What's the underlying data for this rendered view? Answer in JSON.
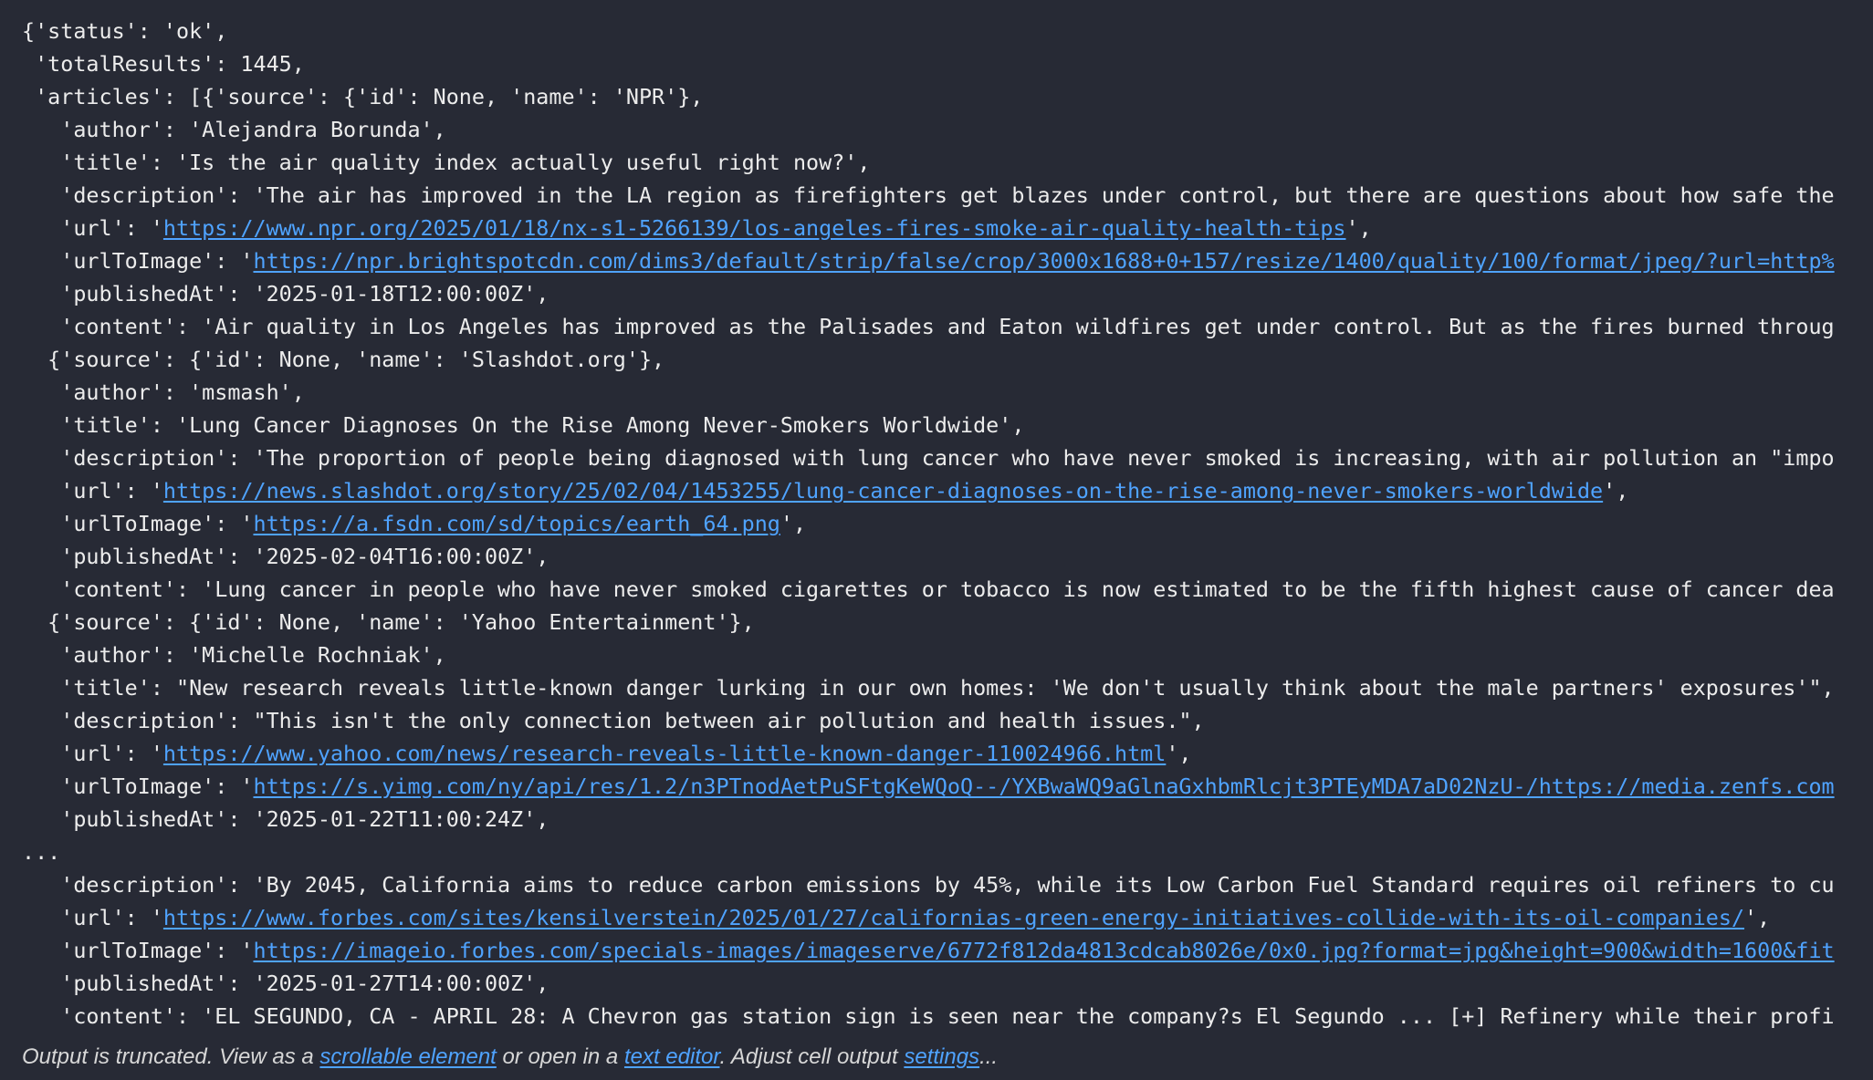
{
  "output": {
    "lines": [
      {
        "text": "{'status': 'ok',"
      },
      {
        "text": " 'totalResults': 1445,"
      },
      {
        "text": " 'articles': [{'source': {'id': None, 'name': 'NPR'},"
      },
      {
        "text": "   'author': 'Alejandra Borunda',"
      },
      {
        "text": "   'title': 'Is the air quality index actually useful right now?',"
      },
      {
        "text": "   'description': 'The air has improved in the LA region as firefighters get blazes under control, but there are questions about how safe the"
      },
      {
        "prefix": "   'url': '",
        "link": "https://www.npr.org/2025/01/18/nx-s1-5266139/los-angeles-fires-smoke-air-quality-health-tips",
        "suffix": "',"
      },
      {
        "prefix": "   'urlToImage': '",
        "link": "https://npr.brightspotcdn.com/dims3/default/strip/false/crop/3000x1688+0+157/resize/1400/quality/100/format/jpeg/?url=http%",
        "suffix": ""
      },
      {
        "text": "   'publishedAt': '2025-01-18T12:00:00Z',"
      },
      {
        "text": "   'content': 'Air quality in Los Angeles has improved as the Palisades and Eaton wildfires get under control. But as the fires burned throug"
      },
      {
        "text": "  {'source': {'id': None, 'name': 'Slashdot.org'},"
      },
      {
        "text": "   'author': 'msmash',"
      },
      {
        "text": "   'title': 'Lung Cancer Diagnoses On the Rise Among Never-Smokers Worldwide',"
      },
      {
        "text": "   'description': 'The proportion of people being diagnosed with lung cancer who have never smoked is increasing, with air pollution an \"impo"
      },
      {
        "prefix": "   'url': '",
        "link": "https://news.slashdot.org/story/25/02/04/1453255/lung-cancer-diagnoses-on-the-rise-among-never-smokers-worldwide",
        "suffix": "',"
      },
      {
        "prefix": "   'urlToImage': '",
        "link": "https://a.fsdn.com/sd/topics/earth_64.png",
        "suffix": "',"
      },
      {
        "text": "   'publishedAt': '2025-02-04T16:00:00Z',"
      },
      {
        "text": "   'content': 'Lung cancer in people who have never smoked cigarettes or tobacco is now estimated to be the fifth highest cause of cancer dea"
      },
      {
        "text": "  {'source': {'id': None, 'name': 'Yahoo Entertainment'},"
      },
      {
        "text": "   'author': 'Michelle Rochniak',"
      },
      {
        "text": "   'title': \"New research reveals little-known danger lurking in our own homes: 'We don't usually think about the male partners' exposures'\","
      },
      {
        "text": "   'description': \"This isn't the only connection between air pollution and health issues.\","
      },
      {
        "prefix": "   'url': '",
        "link": "https://www.yahoo.com/news/research-reveals-little-known-danger-110024966.html",
        "suffix": "',"
      },
      {
        "prefix": "   'urlToImage': '",
        "link": "https://s.yimg.com/ny/api/res/1.2/n3PTnodAetPuSFtgKeWQoQ--/YXBwaWQ9aGlnaGxhbmRlcjt3PTEyMDA7aD02NzU-/https://media.zenfs.com",
        "suffix": ""
      },
      {
        "text": "   'publishedAt': '2025-01-22T11:00:24Z',"
      },
      {
        "text": "..."
      },
      {
        "text": "   'description': 'By 2045, California aims to reduce carbon emissions by 45%, while its Low Carbon Fuel Standard requires oil refiners to cu"
      },
      {
        "prefix": "   'url': '",
        "link": "https://www.forbes.com/sites/kensilverstein/2025/01/27/californias-green-energy-initiatives-collide-with-its-oil-companies/",
        "suffix": "',"
      },
      {
        "prefix": "   'urlToImage': '",
        "link": "https://imageio.forbes.com/specials-images/imageserve/6772f812da4813cdcab8026e/0x0.jpg?format=jpg&height=900&width=1600&fit",
        "suffix": ""
      },
      {
        "text": "   'publishedAt': '2025-01-27T14:00:00Z',"
      },
      {
        "text": "   'content': 'EL SEGUNDO, CA - APRIL 28: A Chevron gas station sign is seen near the company?s El Segundo ... [+] Refinery while their profi"
      }
    ]
  },
  "message": {
    "part1": "Output is truncated. View as a ",
    "link1": "scrollable element",
    "part2": " or open in a ",
    "link2": "text editor",
    "part3": ". Adjust cell output ",
    "link3": "settings",
    "part4": "..."
  }
}
